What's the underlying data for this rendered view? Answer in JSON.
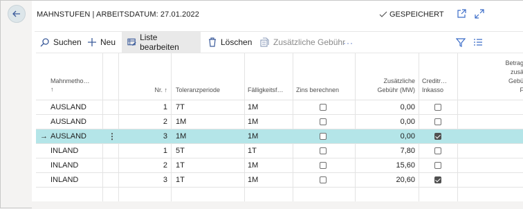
{
  "header": {
    "title": "MAHNSTUFEN | ARBEITSDATUM: 27.01.2022",
    "saved_label": "GESPEICHERT"
  },
  "toolbar": {
    "search_label": "Suchen",
    "new_label": "Neu",
    "edit_list_label": "Liste bearbeiten",
    "delete_label": "Löschen",
    "extra_fee_label": "Zusätzliche Gebühr",
    "more_label": "···"
  },
  "columns": {
    "method": "Mahnmetho…",
    "method_sort": "↑",
    "nr": "Nr. ↑",
    "tolerance": "Toleranzperiode",
    "due": "Fälligkeitsf…",
    "interest": "Zins berechnen",
    "fee1": "Zusätzliche",
    "fee2": "Gebühr (MW)",
    "credit1": "Creditr…",
    "credit2": "Inkasso",
    "amount1": "Betrag",
    "amount2": "zusä",
    "amount3": "Gebü",
    "amount4": "F"
  },
  "rows": [
    {
      "method": "AUSLAND",
      "nr": "1",
      "tolerance": "7T",
      "due": "1M",
      "interest": false,
      "fee": "0,00",
      "credit": false
    },
    {
      "method": "AUSLAND",
      "nr": "2",
      "tolerance": "1M",
      "due": "1M",
      "interest": false,
      "fee": "0,00",
      "credit": false
    },
    {
      "method": "AUSLAND",
      "nr": "3",
      "tolerance": "1M",
      "due": "1M",
      "interest": false,
      "fee": "0,00",
      "credit": true,
      "selected": true
    },
    {
      "method": "INLAND",
      "nr": "1",
      "tolerance": "5T",
      "due": "1T",
      "interest": false,
      "fee": "7,80",
      "credit": false
    },
    {
      "method": "INLAND",
      "nr": "2",
      "tolerance": "1T",
      "due": "1M",
      "interest": false,
      "fee": "15,60",
      "credit": false
    },
    {
      "method": "INLAND",
      "nr": "3",
      "tolerance": "1T",
      "due": "1M",
      "interest": false,
      "fee": "20,60",
      "credit": true
    }
  ],
  "selected_row_marker": "→",
  "row_menu_glyph": "⋮",
  "colors": {
    "accent": "#4a6cc0",
    "selected_row": "#b4e5e8",
    "active_tool": "#e9e9e9"
  }
}
